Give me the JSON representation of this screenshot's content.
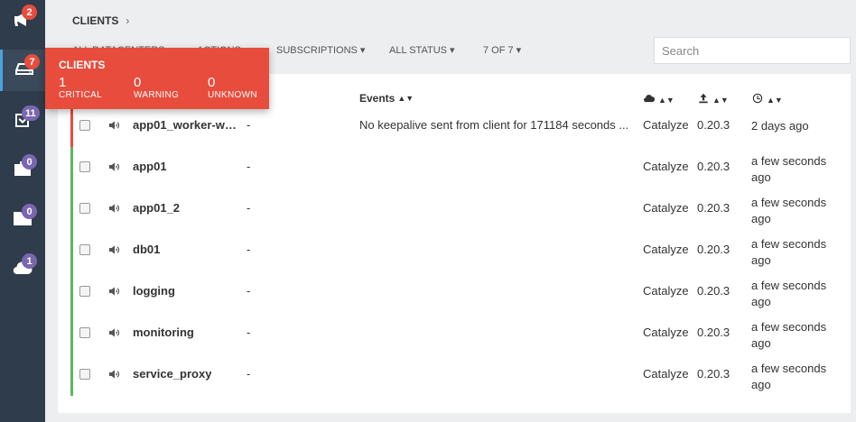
{
  "sidebar": {
    "items": [
      {
        "icon": "megaphone-icon",
        "badge": "2",
        "badge_color": "#e74c3c"
      },
      {
        "icon": "server-icon",
        "badge": "7",
        "badge_color": "#e74c3c"
      },
      {
        "icon": "checkbox-icon",
        "badge": "11",
        "badge_color": "#7a66b0"
      },
      {
        "icon": "briefcase-icon",
        "badge": "0",
        "badge_color": "#7a66b0"
      },
      {
        "icon": "folder-icon",
        "badge": "0",
        "badge_color": "#7a66b0"
      },
      {
        "icon": "cloud-icon",
        "badge": "1",
        "badge_color": "#7a66b0"
      }
    ]
  },
  "breadcrumb": {
    "title": "CLIENTS",
    "chevron": "›"
  },
  "filters": {
    "datacenters": "ALL DATACENTERS ▾",
    "actions": "ACTIONS ▾",
    "subscriptions": "SUBSCRIPTIONS ▾",
    "status": "ALL STATUS ▾",
    "count": "7 OF 7 ▾"
  },
  "search": {
    "placeholder": "Search"
  },
  "table": {
    "headers": {
      "events": "Events",
      "sort": "▲▼"
    },
    "rows": [
      {
        "name": "app01_worker-wo...",
        "dash": "-",
        "event": "No keepalive sent from client for 171184 seconds ...",
        "dc": "Catalyze",
        "version": "0.20.3",
        "last_seen": "2 days ago",
        "status": "critical"
      },
      {
        "name": "app01",
        "dash": "-",
        "event": "",
        "dc": "Catalyze",
        "version": "0.20.3",
        "last_seen": "a few seconds ago",
        "status": "ok"
      },
      {
        "name": "app01_2",
        "dash": "-",
        "event": "",
        "dc": "Catalyze",
        "version": "0.20.3",
        "last_seen": "a few seconds ago",
        "status": "ok"
      },
      {
        "name": "db01",
        "dash": "-",
        "event": "",
        "dc": "Catalyze",
        "version": "0.20.3",
        "last_seen": "a few seconds ago",
        "status": "ok"
      },
      {
        "name": "logging",
        "dash": "-",
        "event": "",
        "dc": "Catalyze",
        "version": "0.20.3",
        "last_seen": "a few seconds ago",
        "status": "ok"
      },
      {
        "name": "monitoring",
        "dash": "-",
        "event": "",
        "dc": "Catalyze",
        "version": "0.20.3",
        "last_seen": "a few seconds ago",
        "status": "ok"
      },
      {
        "name": "service_proxy",
        "dash": "-",
        "event": "",
        "dc": "Catalyze",
        "version": "0.20.3",
        "last_seen": "a few seconds ago",
        "status": "ok"
      }
    ]
  },
  "status_colors": {
    "critical": "#e74c3c",
    "ok": "#5cb85c"
  },
  "popup": {
    "title": "CLIENTS",
    "critical": {
      "value": "1",
      "label": "CRITICAL"
    },
    "warning": {
      "value": "0",
      "label": "WARNING"
    },
    "unknown": {
      "value": "0",
      "label": "UNKNOWN"
    }
  }
}
